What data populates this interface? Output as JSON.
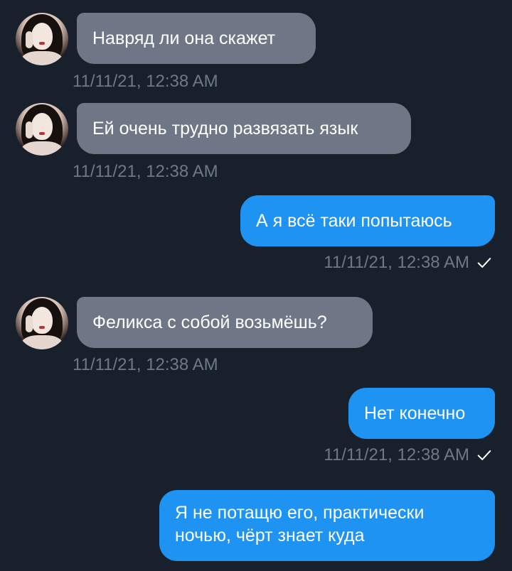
{
  "conversation": {
    "messages": [
      {
        "direction": "incoming",
        "text": "Навряд ли она скажет",
        "timestamp": "11/11/21, 12:38 AM"
      },
      {
        "direction": "incoming",
        "text": "Ей очень трудно развязать язык",
        "timestamp": "11/11/21, 12:38 AM"
      },
      {
        "direction": "outgoing",
        "text": "А я всё таки попытаюсь",
        "timestamp": "11/11/21, 12:38 AM",
        "status": "sent"
      },
      {
        "direction": "incoming",
        "text": "Феликса с собой возьмёшь?",
        "timestamp": "11/11/21, 12:38 AM"
      },
      {
        "direction": "outgoing",
        "text": "Нет конечно",
        "timestamp": "11/11/21, 12:38 AM",
        "status": "sent"
      },
      {
        "direction": "outgoing",
        "text": "Я не потащю его, практически ночью, чёрт знает куда"
      }
    ]
  },
  "colors": {
    "background": "#18202c",
    "incoming_bubble": "#6f7787",
    "outgoing_bubble": "#1f93f2",
    "timestamp": "#6f7888"
  },
  "icons": {
    "sent_status": "checkmark-icon",
    "avatar": "user-avatar"
  }
}
